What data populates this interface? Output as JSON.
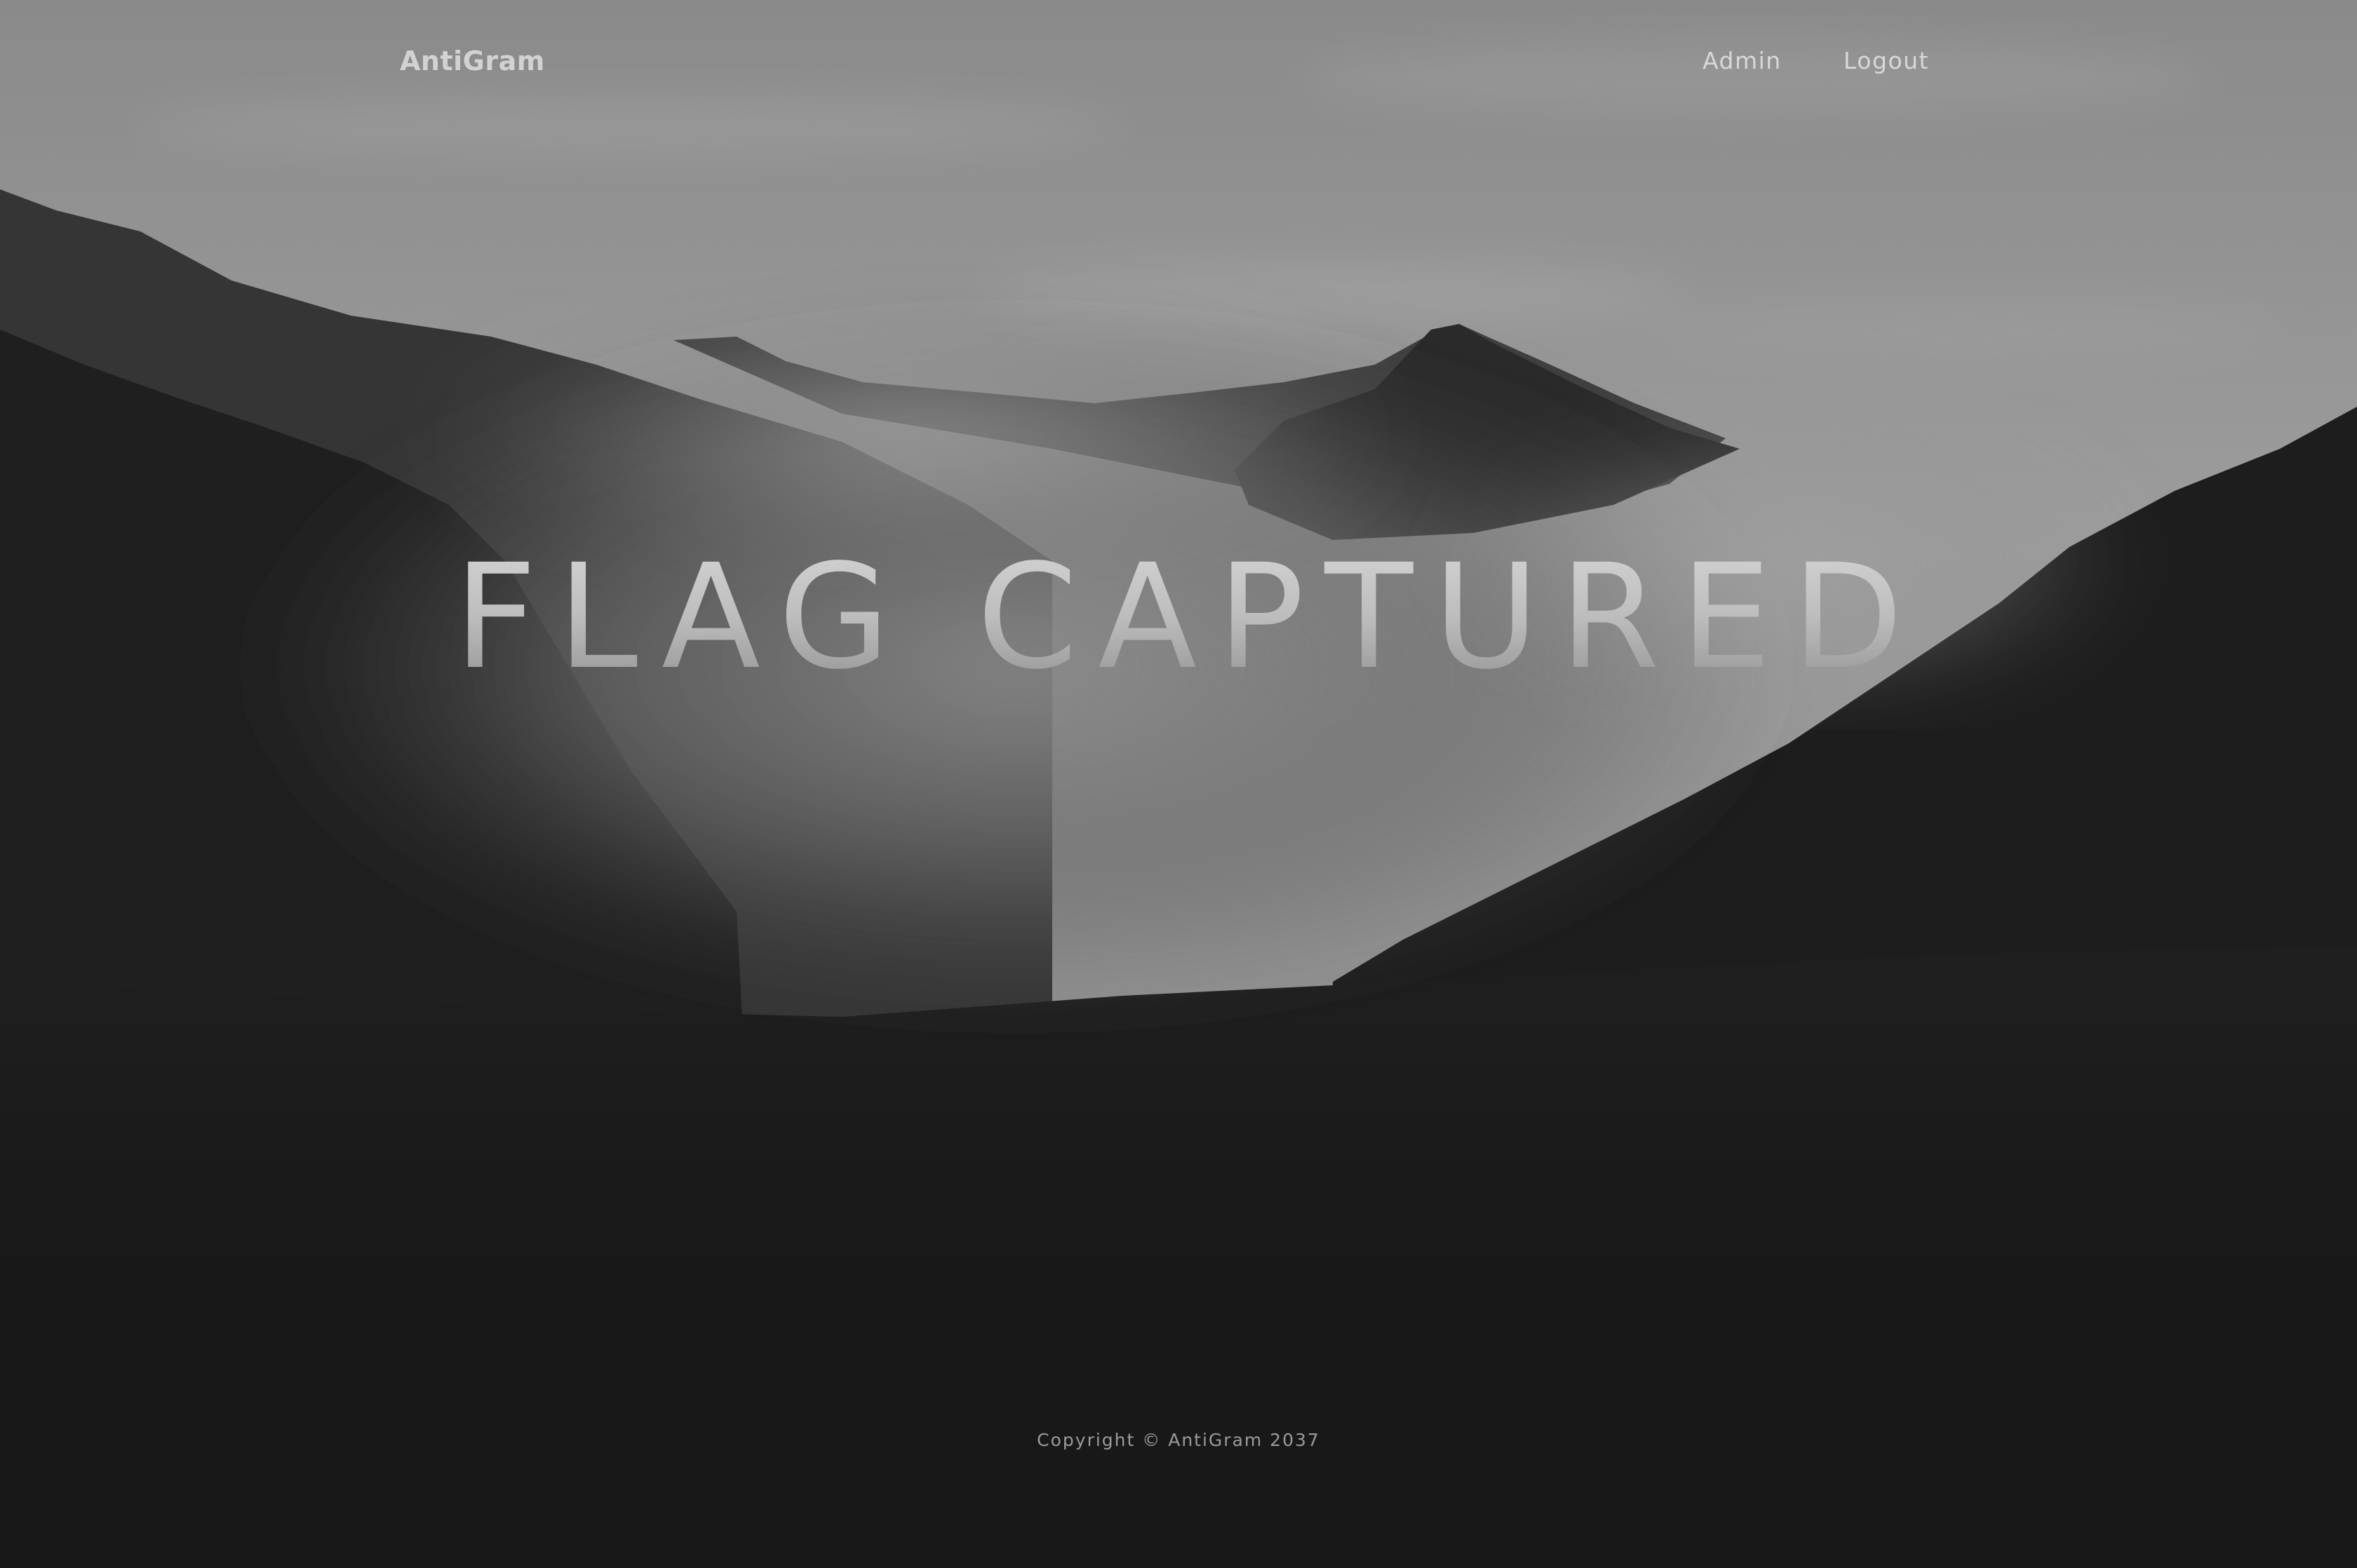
{
  "navbar": {
    "brand": "AntiGram",
    "links": [
      {
        "label": "Admin"
      },
      {
        "label": "Logout"
      }
    ]
  },
  "hero": {
    "title": "FLAG CAPTURED",
    "background": "misty-mountains-photo"
  },
  "footer": {
    "copyright": "Copyright © AntiGram 2037"
  },
  "colors": {
    "page_background": "#181818",
    "nav_text": "#d8d8d8",
    "title_top": "#d6d6d6",
    "title_bottom": "#8e8e8e",
    "footer_text": "#9a9a9a"
  }
}
